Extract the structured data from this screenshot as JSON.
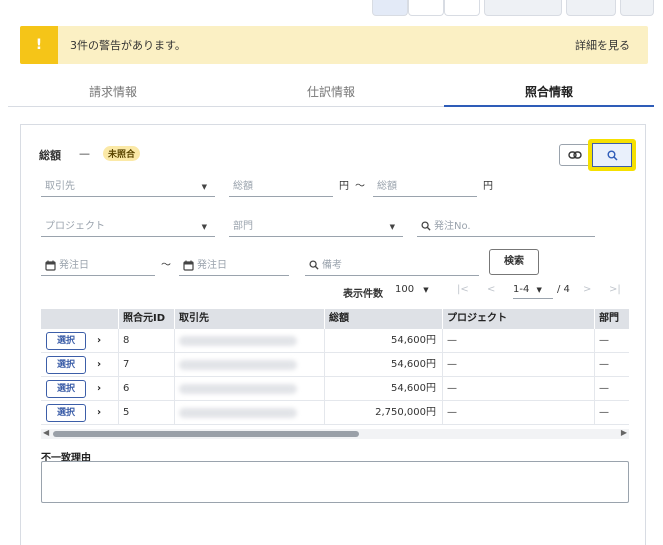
{
  "warning": {
    "icon": "exclamation-icon",
    "message": "3件の警告があります。",
    "link": "詳細を見る"
  },
  "tabs": [
    {
      "label": "請求情報",
      "active": false
    },
    {
      "label": "仕訳情報",
      "active": false
    },
    {
      "label": "照合情報",
      "active": true
    }
  ],
  "summary": {
    "total_label": "総額",
    "total_value": "—",
    "status": "未照合"
  },
  "filters": {
    "partner": "取引先",
    "amount_from": "総額",
    "yen": "円",
    "range_sep": "〜",
    "amount_to": "総額",
    "project": "プロジェクト",
    "department": "部門",
    "po_number": "発注No.",
    "order_date_from": "発注日",
    "order_date_to": "発注日",
    "notes": "備考",
    "search_button": "検索"
  },
  "pager": {
    "label": "表示件数",
    "per_page": "100",
    "range": "1-4",
    "total": "/ 4"
  },
  "table": {
    "columns": [
      "",
      "照合元ID",
      "取引先",
      "総額",
      "プロジェクト",
      "部門"
    ],
    "select_label": "選択",
    "rows": [
      {
        "id": "8",
        "amount": "54,600円",
        "project": "—",
        "department": "—"
      },
      {
        "id": "7",
        "amount": "54,600円",
        "project": "—",
        "department": "—"
      },
      {
        "id": "6",
        "amount": "54,600円",
        "project": "—",
        "department": "—"
      },
      {
        "id": "5",
        "amount": "2,750,000円",
        "project": "—",
        "department": "—"
      }
    ]
  },
  "mismatch": {
    "label": "不一致理由",
    "value": ""
  },
  "colors": {
    "accent": "#2e5cb8",
    "warning_bg": "#fbf0c4",
    "warning_icon": "#f5c518",
    "highlight": "#f5e000"
  }
}
